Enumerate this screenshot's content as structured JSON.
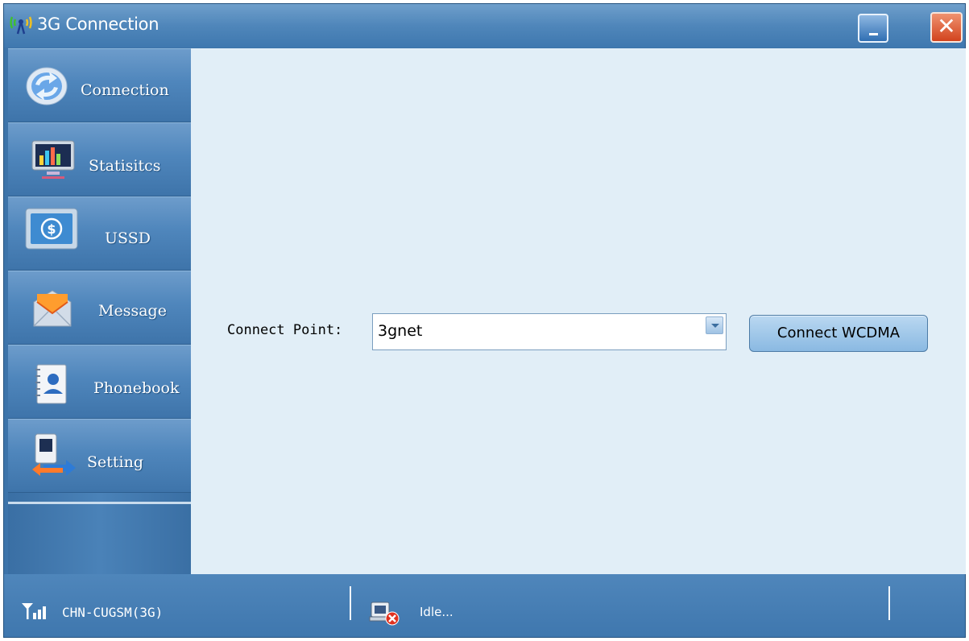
{
  "window": {
    "title": "3G Connection"
  },
  "sidebar": {
    "items": [
      {
        "label": "Connection"
      },
      {
        "label": "Statisitcs"
      },
      {
        "label": "USSD"
      },
      {
        "label": "Message"
      },
      {
        "label": "Phonebook"
      },
      {
        "label": "Setting"
      }
    ]
  },
  "main": {
    "connect_point_label": "Connect Point:",
    "connect_point_value": "3gnet",
    "connect_button": "Connect WCDMA"
  },
  "status": {
    "network": "CHN-CUGSM(3G)",
    "state": "Idle..."
  },
  "colors": {
    "accent": "#4f86bc",
    "content_bg": "#e1eef7"
  }
}
